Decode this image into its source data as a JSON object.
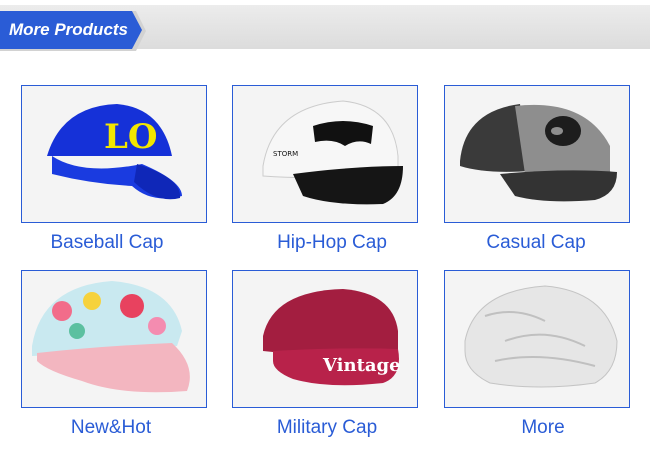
{
  "header": {
    "title": "More Products",
    "accent_color": "#2a5cd6"
  },
  "products": [
    {
      "label": "Baseball Cap",
      "image_icon": "blue-baseball-cap-image"
    },
    {
      "label": "Hip-Hop Cap",
      "image_icon": "white-snapback-cap-image"
    },
    {
      "label": "Casual Cap",
      "image_icon": "gray-trucker-cap-image"
    },
    {
      "label": "New&Hot",
      "image_icon": "floral-pink-cap-image"
    },
    {
      "label": "Military Cap",
      "image_icon": "red-military-cap-image"
    },
    {
      "label": "More",
      "image_icon": "white-flat-cap-image"
    }
  ]
}
